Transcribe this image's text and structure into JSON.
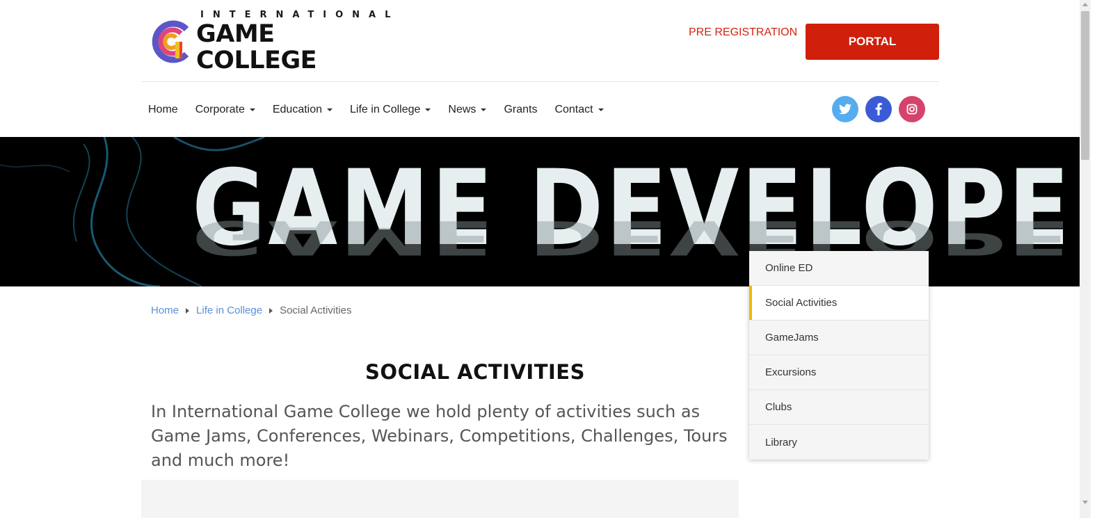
{
  "header": {
    "logo_top": "INTERNATIONAL",
    "logo_main": "GAME COLLEGE",
    "pre_registration": "PRE REGISTRATION",
    "portal": "PORTAL"
  },
  "nav": {
    "items": [
      {
        "label": "Home"
      },
      {
        "label": "Corporate"
      },
      {
        "label": "Education"
      },
      {
        "label": "Life in College"
      },
      {
        "label": "News"
      },
      {
        "label": "Grants"
      },
      {
        "label": "Contact"
      }
    ]
  },
  "social": [
    {
      "icon": "twitter-icon",
      "color": "#55acee"
    },
    {
      "icon": "facebook-icon",
      "color": "#3b5bd6"
    },
    {
      "icon": "instagram-icon",
      "color": "#d4436c"
    }
  ],
  "hero": {
    "title": "GAME DEVELOPER"
  },
  "breadcrumb": {
    "home": "Home",
    "parent": "Life in College",
    "current": "Social Activities"
  },
  "main": {
    "title": "SOCIAL ACTIVITIES",
    "intro": "In International Game College we hold plenty of activities such as Game Jams, Conferences, Webinars, Competitions, Challenges, Tours and much more!"
  },
  "side_menu": {
    "items": [
      {
        "label": "Online ED"
      },
      {
        "label": "Social Activities",
        "active": true
      },
      {
        "label": "GameJams"
      },
      {
        "label": "Excursions"
      },
      {
        "label": "Clubs"
      },
      {
        "label": "Library"
      }
    ]
  },
  "colors": {
    "accent_red": "#d01f0a",
    "link_blue": "#5b8fd6",
    "active_marker": "#f0b90b"
  }
}
